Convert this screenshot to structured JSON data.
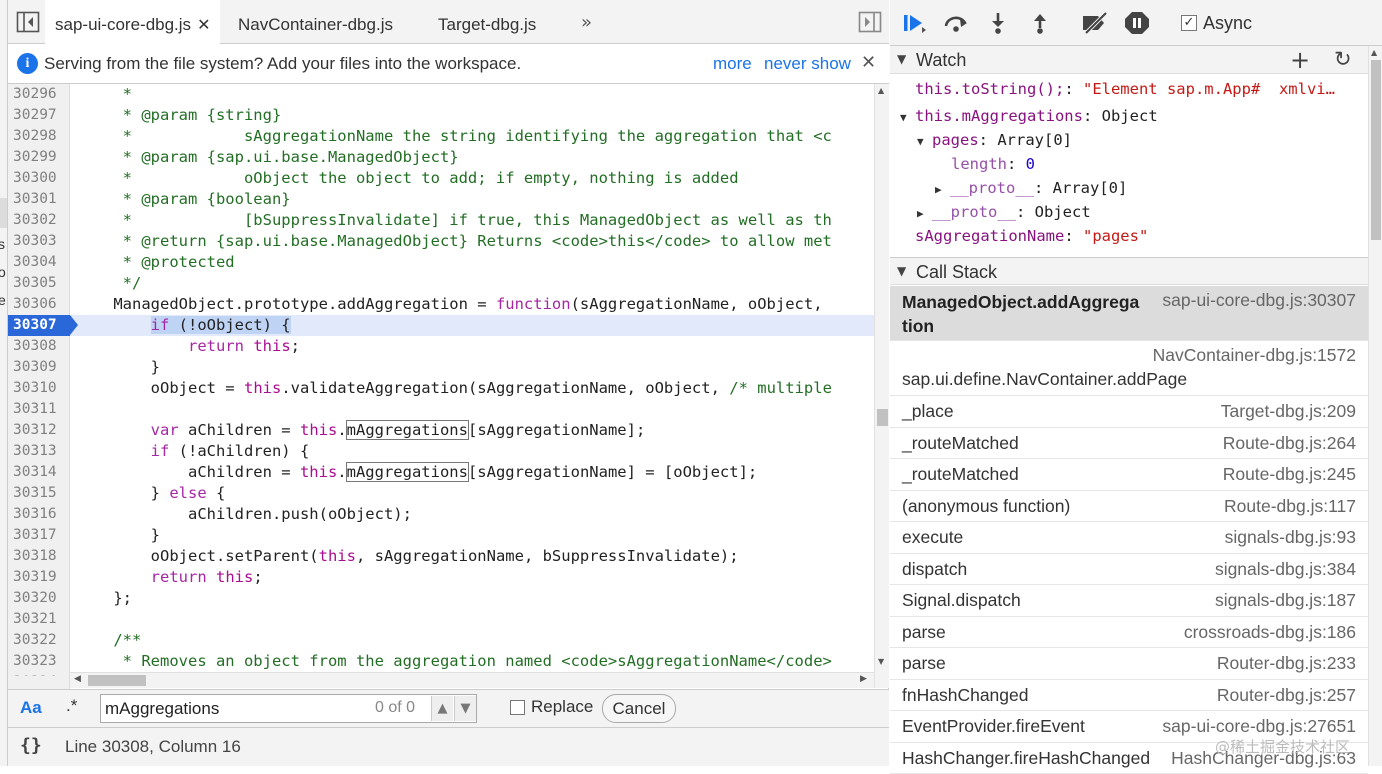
{
  "editor": {
    "tabs": [
      {
        "label": "sap-ui-core-dbg.js",
        "active": true,
        "closable": true
      },
      {
        "label": "NavContainer-dbg.js",
        "active": false
      },
      {
        "label": "Target-dbg.js",
        "active": false
      }
    ],
    "tab_overflow_icon": "double-chevron-right-icon",
    "infobar": {
      "message": "Serving from the file system? Add your files into the workspace.",
      "more_link": "more",
      "never_show_link": "never show"
    },
    "code_lines": [
      {
        "num": "30296",
        "text": "     *"
      },
      {
        "num": "30297",
        "text": "     * @param {string}"
      },
      {
        "num": "30298",
        "text": "     *            sAggregationName the string identifying the aggregation that <c"
      },
      {
        "num": "30299",
        "text": "     * @param {sap.ui.base.ManagedObject}"
      },
      {
        "num": "30300",
        "text": "     *            oObject the object to add; if empty, nothing is added"
      },
      {
        "num": "30301",
        "text": "     * @param {boolean}"
      },
      {
        "num": "30302",
        "text": "     *            [bSuppressInvalidate] if true, this ManagedObject as well as th"
      },
      {
        "num": "30303",
        "text": "     * @return {sap.ui.base.ManagedObject} Returns <code>this</code> to allow met"
      },
      {
        "num": "30304",
        "text": "     * @protected"
      },
      {
        "num": "30305",
        "text": "     */"
      },
      {
        "num": "30306",
        "text": "    ManagedObject.prototype.addAggregation = function(sAggregationName, oObject, "
      },
      {
        "num": "30307",
        "text": "        if (!oObject) {"
      },
      {
        "num": "30308",
        "text": "            return this;"
      },
      {
        "num": "30309",
        "text": "        }"
      },
      {
        "num": "30310",
        "text": "        oObject = this.validateAggregation(sAggregationName, oObject, /* multiple"
      },
      {
        "num": "30311",
        "text": ""
      },
      {
        "num": "30312",
        "text": "        var aChildren = this.mAggregations[sAggregationName];"
      },
      {
        "num": "30313",
        "text": "        if (!aChildren) {"
      },
      {
        "num": "30314",
        "text": "            aChildren = this.mAggregations[sAggregationName] = [oObject];"
      },
      {
        "num": "30315",
        "text": "        } else {"
      },
      {
        "num": "30316",
        "text": "            aChildren.push(oObject);"
      },
      {
        "num": "30317",
        "text": "        }"
      },
      {
        "num": "30318",
        "text": "        oObject.setParent(this, sAggregationName, bSuppressInvalidate);"
      },
      {
        "num": "30319",
        "text": "        return this;"
      },
      {
        "num": "30320",
        "text": "    };"
      },
      {
        "num": "30321",
        "text": ""
      },
      {
        "num": "30322",
        "text": "    /**"
      },
      {
        "num": "30323",
        "text": "     * Removes an object from the aggregation named <code>sAggregationName</code>"
      },
      {
        "num": "30324",
        "text": ""
      }
    ],
    "current_line": "30307",
    "search": {
      "match_case_label": "Aa",
      "regex_label": ".*",
      "query": "mAggregations",
      "count": "0 of 0",
      "replace_label": "Replace",
      "cancel_label": "Cancel"
    },
    "status": {
      "pretty_print_label": "{}",
      "position": "Line 30308, Column 16"
    }
  },
  "debugger": {
    "async_label": "Async",
    "async_checked": true,
    "watch": {
      "title": "Watch",
      "items": [
        {
          "expr": "this.toString();",
          "value": "\"Element sap.m.App#  xmlvi…"
        },
        {
          "expr": "this.mAggregations",
          "value": "Object"
        },
        {
          "expr": "pages",
          "value": "Array[0]"
        },
        {
          "expr": "length",
          "value": "0"
        },
        {
          "expr": "__proto__",
          "value": "Array[0]"
        },
        {
          "expr": "__proto__",
          "value": "Object"
        },
        {
          "expr": "sAggregationName",
          "value": "\"pages\""
        }
      ]
    },
    "call_stack": {
      "title": "Call Stack",
      "frames": [
        {
          "fn_line1": "ManagedObject.addAggrega",
          "fn_line2": "tion",
          "loc": "sap-ui-core-dbg.js:30307"
        },
        {
          "fn": "sap.ui.define.NavContainer.addPage",
          "loc": "NavContainer-dbg.js:1572"
        },
        {
          "fn": "_place",
          "loc": "Target-dbg.js:209"
        },
        {
          "fn": "_routeMatched",
          "loc": "Route-dbg.js:264"
        },
        {
          "fn": "_routeMatched",
          "loc": "Route-dbg.js:245"
        },
        {
          "fn": "(anonymous function)",
          "loc": "Route-dbg.js:117"
        },
        {
          "fn": "execute",
          "loc": "signals-dbg.js:93"
        },
        {
          "fn": "dispatch",
          "loc": "signals-dbg.js:384"
        },
        {
          "fn": "Signal.dispatch",
          "loc": "signals-dbg.js:187"
        },
        {
          "fn": "parse",
          "loc": "crossroads-dbg.js:186"
        },
        {
          "fn": "parse",
          "loc": "Router-dbg.js:233"
        },
        {
          "fn": "fnHashChanged",
          "loc": "Router-dbg.js:257"
        },
        {
          "fn": "EventProvider.fireEvent",
          "loc": "sap-ui-core-dbg.js:27651"
        },
        {
          "fn": "HashChanger.fireHashChanged",
          "loc": "HashChanger-dbg.js:63"
        }
      ]
    }
  },
  "watermark": "@稀土掘金技术社区",
  "left_strip": [
    "s",
    "o",
    "e"
  ],
  "colors": {
    "accent": "#1a73e8",
    "current_line": "#e1e9fb",
    "breakpoint": "#2a67d9"
  }
}
